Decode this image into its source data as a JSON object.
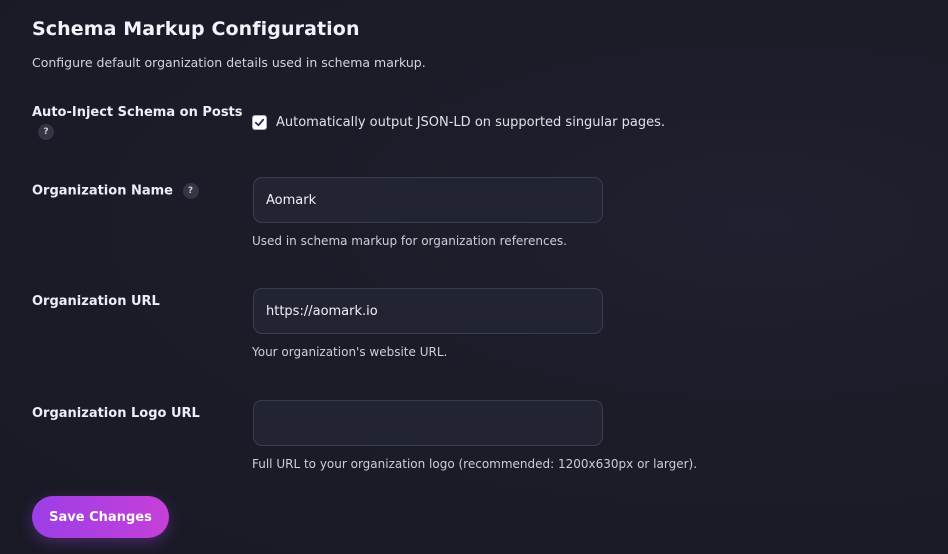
{
  "header": {
    "title": "Schema Markup Configuration",
    "subtitle": "Configure default organization details used in schema markup."
  },
  "auto_inject": {
    "label": "Auto-Inject Schema on Posts",
    "help": "?",
    "checked": true,
    "checkbox_label": "Automatically output JSON-LD on supported singular pages."
  },
  "org_name": {
    "label": "Organization Name",
    "help": "?",
    "value": "Aomark",
    "hint": "Used in schema markup for organization references."
  },
  "org_url": {
    "label": "Organization URL",
    "value": "https://aomark.io",
    "hint": "Your organization's website URL."
  },
  "org_logo": {
    "label": "Organization Logo URL",
    "value": "",
    "hint": "Full URL to your organization logo (recommended: 1200x630px or larger)."
  },
  "actions": {
    "save_label": "Save Changes"
  },
  "colors": {
    "accent_start": "#9c3fe6",
    "accent_end": "#c63fd8",
    "background": "#1b1c28",
    "input_bg": "#222434"
  }
}
